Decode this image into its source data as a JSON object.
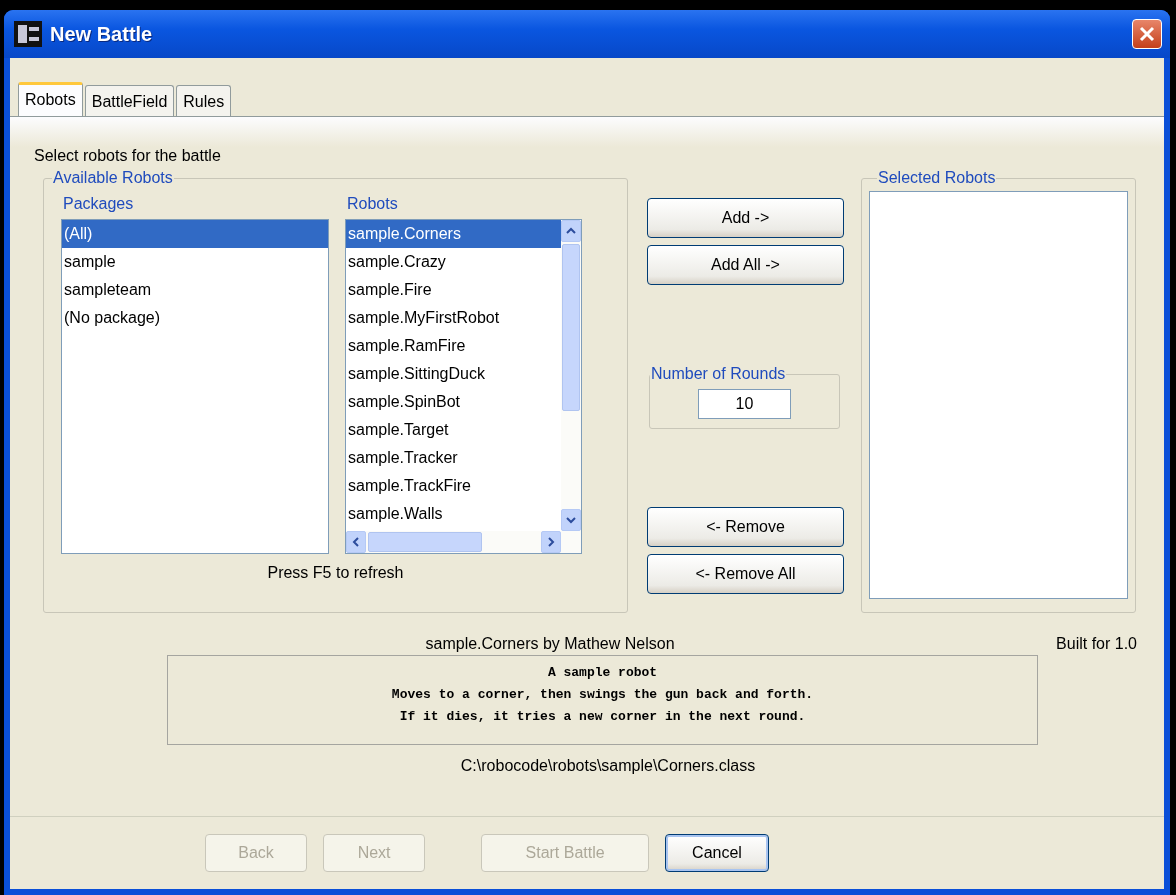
{
  "window": {
    "title": "New Battle"
  },
  "tabs": [
    {
      "label": "Robots",
      "selected": true
    },
    {
      "label": "BattleField",
      "selected": false
    },
    {
      "label": "Rules",
      "selected": false
    }
  ],
  "instruction": "Select robots for the battle",
  "available_robots": {
    "title": "Available Robots",
    "packages": {
      "heading": "Packages",
      "items": [
        {
          "label": "(All)",
          "selected": true
        },
        {
          "label": "sample",
          "selected": false
        },
        {
          "label": "sampleteam",
          "selected": false
        },
        {
          "label": "(No package)",
          "selected": false
        }
      ]
    },
    "robots": {
      "heading": "Robots",
      "items": [
        {
          "label": "sample.Corners",
          "selected": true
        },
        {
          "label": "sample.Crazy",
          "selected": false
        },
        {
          "label": "sample.Fire",
          "selected": false
        },
        {
          "label": "sample.MyFirstRobot",
          "selected": false
        },
        {
          "label": "sample.RamFire",
          "selected": false
        },
        {
          "label": "sample.SittingDuck",
          "selected": false
        },
        {
          "label": "sample.SpinBot",
          "selected": false
        },
        {
          "label": "sample.Target",
          "selected": false
        },
        {
          "label": "sample.Tracker",
          "selected": false
        },
        {
          "label": "sample.TrackFire",
          "selected": false
        },
        {
          "label": "sample.Walls",
          "selected": false
        }
      ]
    },
    "hint": "Press F5 to refresh"
  },
  "add_buttons": [
    "Add ->",
    "Add All ->"
  ],
  "rounds": {
    "label": "Number of Rounds",
    "value": "10"
  },
  "remove_buttons": [
    "<- Remove",
    "<- Remove All"
  ],
  "selected_robots": {
    "title": "Selected Robots"
  },
  "robot_info": {
    "author": "sample.Corners by Mathew Nelson",
    "built_for": "Built for 1.0",
    "description": [
      "A sample robot",
      "Moves to a corner, then swings the gun back and forth.",
      "If it dies, it tries a new corner in the next round."
    ],
    "path": "C:\\robocode\\robots\\sample\\Corners.class"
  },
  "footer_buttons": [
    {
      "label": "Back",
      "disabled": true,
      "default": false
    },
    {
      "label": "Next",
      "disabled": true,
      "default": false
    },
    {
      "label": "Start Battle",
      "disabled": true,
      "default": false
    },
    {
      "label": "Cancel",
      "disabled": false,
      "default": true
    }
  ]
}
